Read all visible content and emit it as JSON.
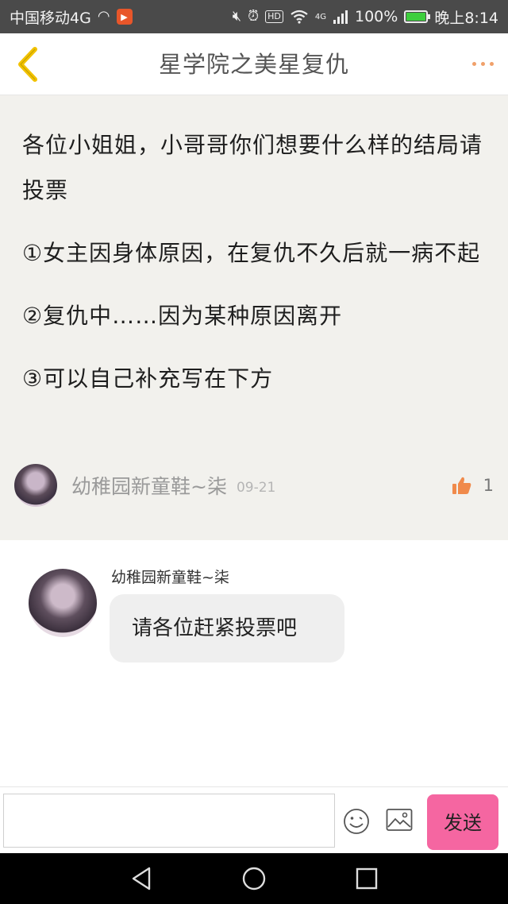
{
  "status_bar": {
    "carrier": "中国移动4G",
    "battery_percent": "100%",
    "battery_level": 1.0,
    "time": "晚上8:14",
    "network_label": "4G",
    "hd_label": "HD",
    "icons": [
      "headset-icon",
      "app-notification-icon",
      "mute-icon",
      "alarm-icon",
      "hd-icon",
      "wifi-icon",
      "signal-icon",
      "battery-icon"
    ]
  },
  "header": {
    "title": "星学院之美星复仇",
    "back_icon": "back-chevron-icon",
    "more_icon": "more-dots-icon"
  },
  "post": {
    "paragraphs": [
      "各位小姐姐，小哥哥你们想要什么样的结局请投票",
      "①女主因身体原因，在复仇不久后就一病不起",
      "②复仇中……因为某种原因离开",
      "③可以自己补充写在下方"
    ],
    "author": "幼稚园新童鞋~柒",
    "date": "09-21",
    "like_count": "1"
  },
  "comment": {
    "author": "幼稚园新童鞋~柒",
    "text": "请各位赶紧投票吧"
  },
  "input_bar": {
    "placeholder": "",
    "send_label": "发送"
  },
  "colors": {
    "status_bg": "#4a4a4a",
    "accent_orange": "#f0a06a",
    "back_yellow": "#f2c200",
    "post_bg": "#f2f1ed",
    "send_pink": "#f566a1"
  }
}
